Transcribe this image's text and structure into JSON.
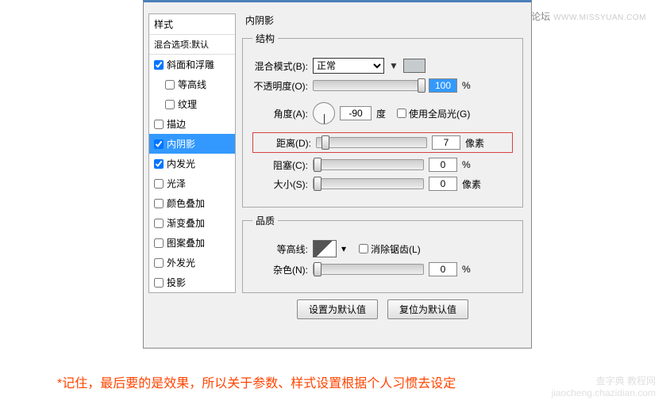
{
  "topright": {
    "site": "思缘设计论坛",
    "url": "WWW.MISSYUAN.COM"
  },
  "sidebar": {
    "header": "样式",
    "subheader": "混合选项:默认",
    "items": [
      {
        "label": "斜面和浮雕",
        "checked": true,
        "indent": false
      },
      {
        "label": "等高线",
        "checked": false,
        "indent": true
      },
      {
        "label": "纹理",
        "checked": false,
        "indent": true
      },
      {
        "label": "描边",
        "checked": false,
        "indent": false
      },
      {
        "label": "内阴影",
        "checked": true,
        "indent": false,
        "selected": true
      },
      {
        "label": "内发光",
        "checked": true,
        "indent": false
      },
      {
        "label": "光泽",
        "checked": false,
        "indent": false
      },
      {
        "label": "颜色叠加",
        "checked": false,
        "indent": false
      },
      {
        "label": "渐变叠加",
        "checked": false,
        "indent": false
      },
      {
        "label": "图案叠加",
        "checked": false,
        "indent": false
      },
      {
        "label": "外发光",
        "checked": false,
        "indent": false
      },
      {
        "label": "投影",
        "checked": false,
        "indent": false
      }
    ]
  },
  "panel": {
    "title": "内阴影",
    "structure_legend": "结构",
    "blend_label": "混合模式(B):",
    "blend_value": "正常",
    "swatch_color": "#c6cbce",
    "swatch_annot": "#c6cbce",
    "opacity_label": "不透明度(O):",
    "opacity_value": "100",
    "opacity_unit": "%",
    "angle_label": "角度(A):",
    "angle_value": "-90",
    "angle_unit": "度",
    "global_light": "使用全局光(G)",
    "distance_label": "距离(D):",
    "distance_value": "7",
    "distance_unit": "像素",
    "choke_label": "阻塞(C):",
    "choke_value": "0",
    "choke_unit": "%",
    "size_label": "大小(S):",
    "size_value": "0",
    "size_unit": "像素",
    "quality_legend": "品质",
    "contour_label": "等高线:",
    "antialias": "消除锯齿(L)",
    "noise_label": "杂色(N):",
    "noise_value": "0",
    "noise_unit": "%",
    "btn_default": "设置为默认值",
    "btn_reset": "复位为默认值"
  },
  "note": "*记住，最后要的是效果，所以关于参数、样式设置根据个人习惯去设定",
  "watermark": {
    "l1": "查字典 教程网",
    "l2": "jiaocheng.chazidian.com"
  }
}
